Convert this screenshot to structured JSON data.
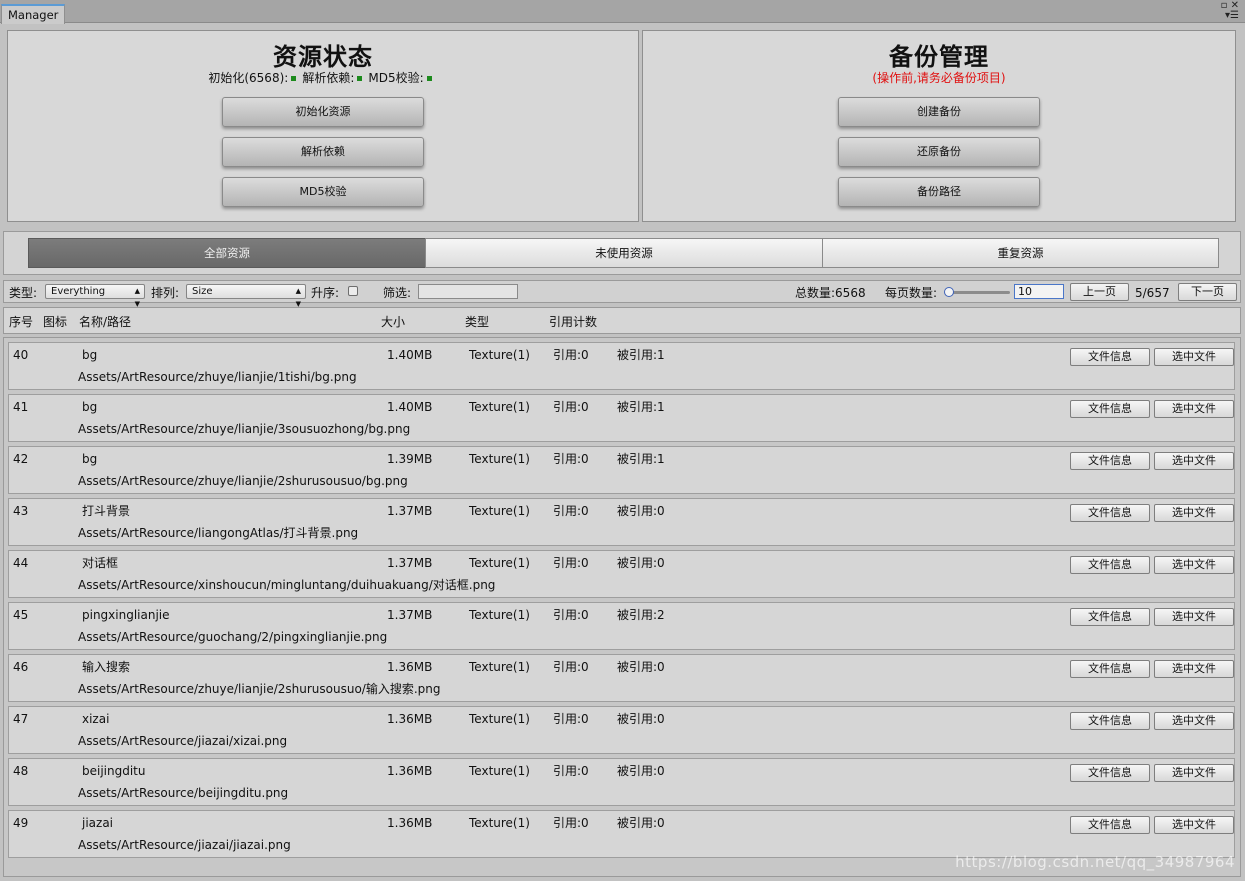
{
  "window": {
    "tab_title": "Manager",
    "controls": "▫ ✕\n▾☰"
  },
  "resource_status": {
    "title": "资源状态",
    "indicators": [
      {
        "label": "初始化(6568):",
        "color": "#1c8a1c"
      },
      {
        "label": "解析依赖:",
        "color": "#1c8a1c"
      },
      {
        "label": "MD5校验:",
        "color": "#1c8a1c"
      }
    ],
    "buttons": [
      "初始化资源",
      "解析依赖",
      "MD5校验"
    ]
  },
  "backup": {
    "title": "备份管理",
    "warning": "(操作前,请务必备份项目)",
    "buttons": [
      "创建备份",
      "还原备份",
      "备份路径"
    ]
  },
  "filter_tabs": [
    {
      "label": "全部资源",
      "active": true
    },
    {
      "label": "未使用资源",
      "active": false
    },
    {
      "label": "重复资源",
      "active": false
    }
  ],
  "toolbar": {
    "type_label": "类型:",
    "type_value": "Everything",
    "sort_label": "排列:",
    "sort_value": "Size",
    "asc_label": "升序:",
    "ascending": false,
    "search_label": "筛选:",
    "search_value": "",
    "total": "总数量:6568",
    "per_page_label": "每页数量:",
    "per_page_value": "10",
    "prev": "上一页",
    "page": "5/657",
    "next": "下一页"
  },
  "columns": [
    "序号",
    "图标",
    "名称/路径",
    "大小",
    "类型",
    "引用计数"
  ],
  "rows": [
    {
      "index": "40",
      "name": "bg",
      "size": "1.40MB",
      "type": "Texture(1)",
      "refs": "引用:0",
      "referenced": "被引用:1",
      "path": "Assets/ArtResource/zhuye/lianjie/1tishi/bg.png"
    },
    {
      "index": "41",
      "name": "bg",
      "size": "1.40MB",
      "type": "Texture(1)",
      "refs": "引用:0",
      "referenced": "被引用:1",
      "path": "Assets/ArtResource/zhuye/lianjie/3sousuozhong/bg.png"
    },
    {
      "index": "42",
      "name": "bg",
      "size": "1.39MB",
      "type": "Texture(1)",
      "refs": "引用:0",
      "referenced": "被引用:1",
      "path": "Assets/ArtResource/zhuye/lianjie/2shurusousuo/bg.png"
    },
    {
      "index": "43",
      "name": "打斗背景",
      "size": "1.37MB",
      "type": "Texture(1)",
      "refs": "引用:0",
      "referenced": "被引用:0",
      "path": "Assets/ArtResource/liangongAtlas/打斗背景.png"
    },
    {
      "index": "44",
      "name": "对话框",
      "size": "1.37MB",
      "type": "Texture(1)",
      "refs": "引用:0",
      "referenced": "被引用:0",
      "path": "Assets/ArtResource/xinshoucun/mingluntang/duihuakuang/对话框.png"
    },
    {
      "index": "45",
      "name": "pingxinglianjie",
      "size": "1.37MB",
      "type": "Texture(1)",
      "refs": "引用:0",
      "referenced": "被引用:2",
      "path": "Assets/ArtResource/guochang/2/pingxinglianjie.png"
    },
    {
      "index": "46",
      "name": "输入搜索",
      "size": "1.36MB",
      "type": "Texture(1)",
      "refs": "引用:0",
      "referenced": "被引用:0",
      "path": "Assets/ArtResource/zhuye/lianjie/2shurusousuo/输入搜索.png"
    },
    {
      "index": "47",
      "name": "xizai",
      "size": "1.36MB",
      "type": "Texture(1)",
      "refs": "引用:0",
      "referenced": "被引用:0",
      "path": "Assets/ArtResource/jiazai/xizai.png"
    },
    {
      "index": "48",
      "name": "beijingditu",
      "size": "1.36MB",
      "type": "Texture(1)",
      "refs": "引用:0",
      "referenced": "被引用:0",
      "path": "Assets/ArtResource/beijingditu.png"
    },
    {
      "index": "49",
      "name": "jiazai",
      "size": "1.36MB",
      "type": "Texture(1)",
      "refs": "引用:0",
      "referenced": "被引用:0",
      "path": "Assets/ArtResource/jiazai/jiazai.png"
    }
  ],
  "row_buttons": {
    "info": "文件信息",
    "select": "选中文件"
  },
  "watermark": "https://blog.csdn.net/qq_34987964"
}
